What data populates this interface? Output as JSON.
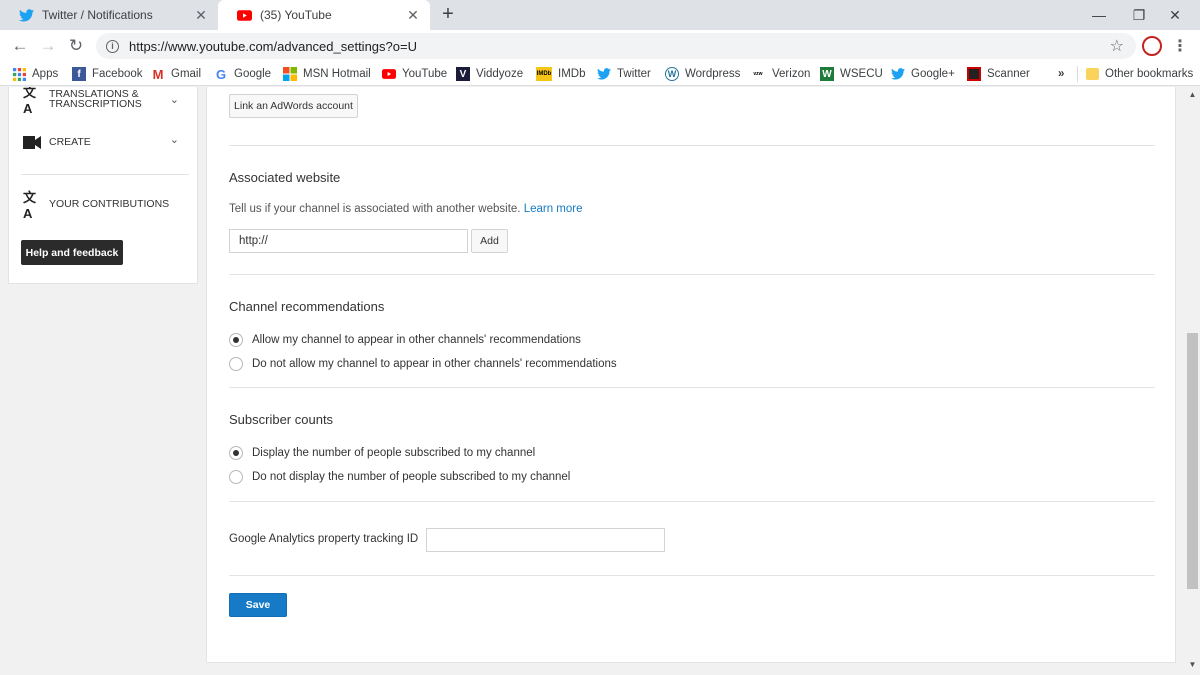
{
  "browser": {
    "tabs": [
      {
        "title": "Twitter / Notifications",
        "icon": "twitter-icon",
        "active": false
      },
      {
        "title": "(35) YouTube",
        "icon": "youtube-icon",
        "active": true
      }
    ],
    "url": "https://www.youtube.com/advanced_settings?o=U",
    "bookmarks": [
      {
        "label": "Apps",
        "icon": "apps-grid-icon"
      },
      {
        "label": "Facebook",
        "icon": "facebook-icon"
      },
      {
        "label": "Gmail",
        "icon": "gmail-icon"
      },
      {
        "label": "Google",
        "icon": "google-icon"
      },
      {
        "label": "MSN Hotmail",
        "icon": "msn-icon"
      },
      {
        "label": "YouTube",
        "icon": "youtube-icon"
      },
      {
        "label": "Viddyoze",
        "icon": "viddyoze-icon"
      },
      {
        "label": "IMDb",
        "icon": "imdb-icon"
      },
      {
        "label": "Twitter",
        "icon": "twitter-icon"
      },
      {
        "label": "Wordpress",
        "icon": "wordpress-icon"
      },
      {
        "label": "Verizon",
        "icon": "verizon-icon"
      },
      {
        "label": "WSECU",
        "icon": "wsecu-icon"
      },
      {
        "label": "Google+",
        "icon": "twitter-icon"
      },
      {
        "label": "Scanner",
        "icon": "scanner-icon"
      }
    ],
    "overflow": "»",
    "other_bookmarks": "Other bookmarks"
  },
  "sidebar": {
    "translations": "TRANSLATIONS & TRANSCRIPTIONS",
    "create": "CREATE",
    "contributions": "YOUR CONTRIBUTIONS",
    "help": "Help and feedback"
  },
  "main": {
    "adwords_button": "Link an AdWords account",
    "website": {
      "title": "Associated website",
      "description": "Tell us if your channel is associated with another website.",
      "learn_more": "Learn more",
      "input_value": "http://",
      "add_button": "Add"
    },
    "recommendations": {
      "title": "Channel recommendations",
      "options": [
        {
          "label": "Allow my channel to appear in other channels' recommendations",
          "selected": true
        },
        {
          "label": "Do not allow my channel to appear in other channels' recommendations",
          "selected": false
        }
      ]
    },
    "subscribers": {
      "title": "Subscriber counts",
      "options": [
        {
          "label": "Display the number of people subscribed to my channel",
          "selected": true
        },
        {
          "label": "Do not display the number of people subscribed to my channel",
          "selected": false
        }
      ]
    },
    "analytics_label": "Google Analytics property tracking ID",
    "analytics_value": "",
    "save_button": "Save"
  },
  "colors": {
    "link": "#167ac6",
    "primary_button": "#167ac6",
    "help_button": "#2b2b2b"
  }
}
